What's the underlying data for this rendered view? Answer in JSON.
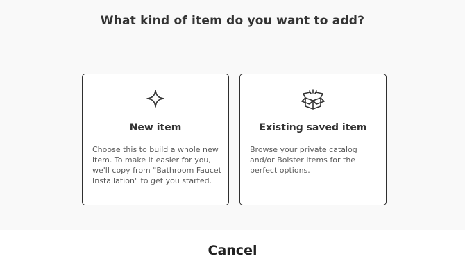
{
  "dialog": {
    "title": "What kind of item do you want to add?",
    "options": [
      {
        "icon": "sparkle-icon",
        "title": "New item",
        "description": "Choose this to build a whole new item. To make it easier for you, we'll copy from \"Bathroom Faucet Installation\" to get you started."
      },
      {
        "icon": "open-box-icon",
        "title": "Existing saved item",
        "description": "Browse your private catalog and/or Bolster items for the perfect options."
      }
    ]
  },
  "footer": {
    "cancel_label": "Cancel"
  },
  "colors": {
    "background": "#f9f9f9",
    "card_border": "#2f2f2f",
    "text": "#333333"
  }
}
